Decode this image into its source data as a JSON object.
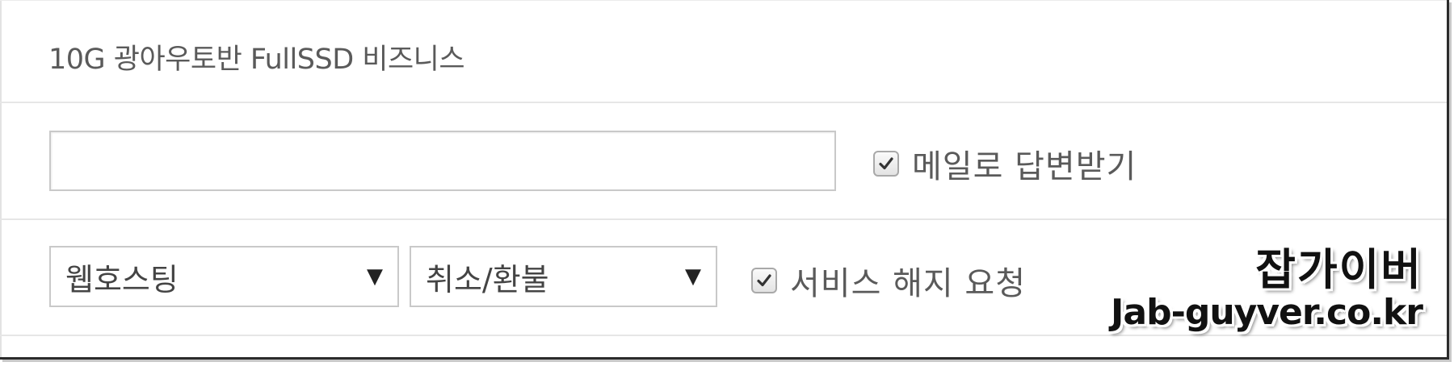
{
  "form": {
    "title": "10G 광아우토반 FullSSD 비즈니스",
    "input": {
      "value": "",
      "placeholder": ""
    },
    "mail_reply": {
      "label": "메일로 답변받기",
      "checked": true
    },
    "category_select": {
      "selected": "웹호스팅",
      "arrow": "▼"
    },
    "type_select": {
      "selected": "취소/환불",
      "arrow": "▼"
    },
    "cancel_request": {
      "label": "서비스 해지 요청",
      "checked": true
    }
  },
  "watermark": {
    "line1": "잡가이버",
    "line2": "Jab-guyver.co.kr"
  },
  "colors": {
    "border": "#c9c9c9",
    "text": "#5a5a5a",
    "divider": "#e6e6e6"
  }
}
